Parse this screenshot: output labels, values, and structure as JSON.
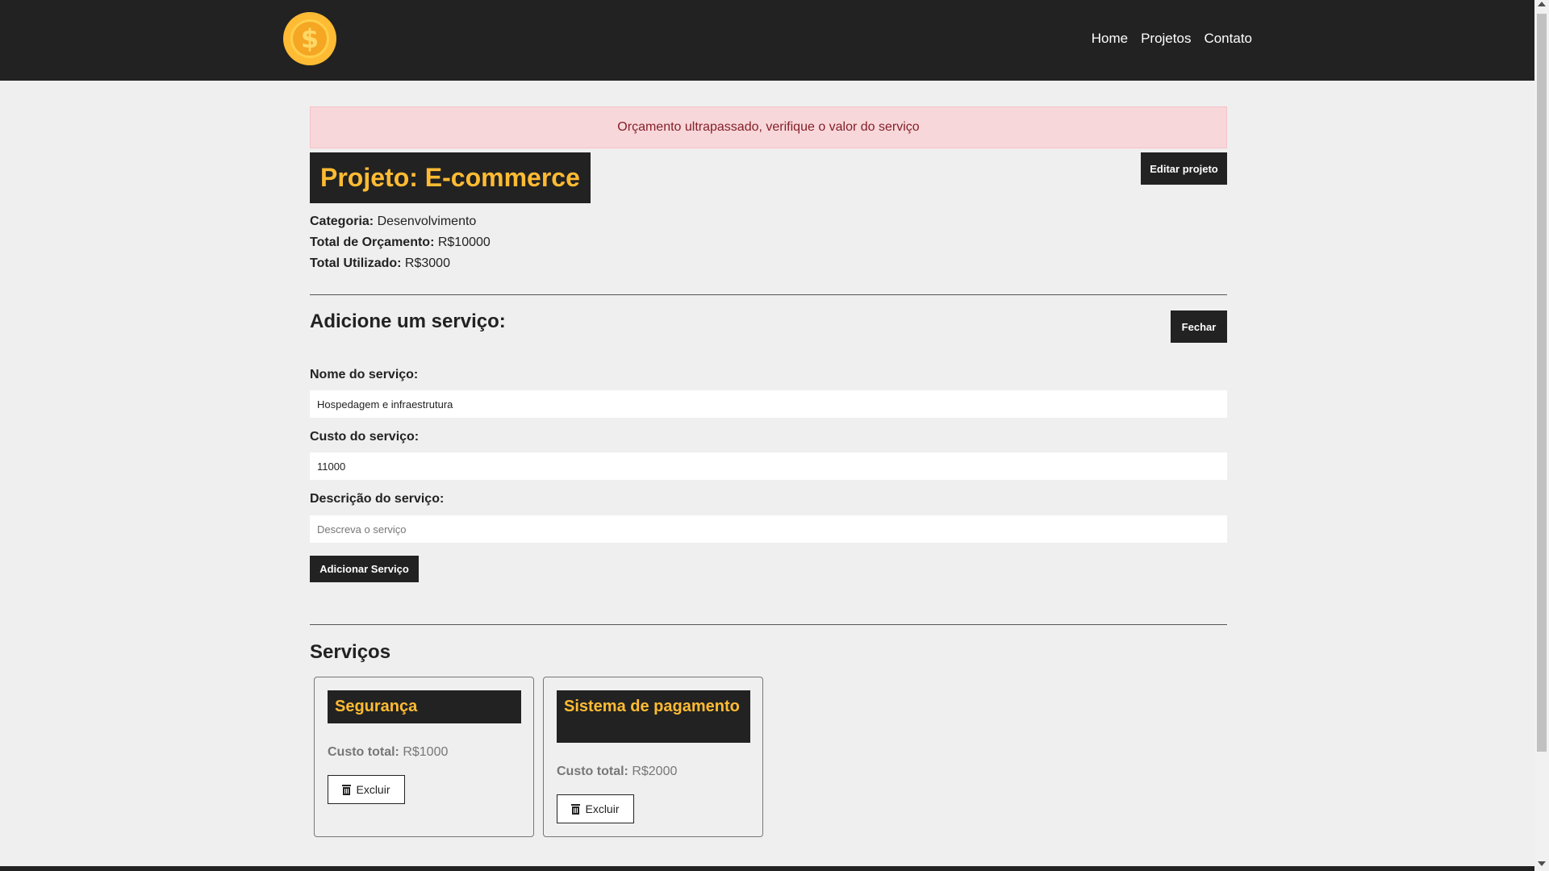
{
  "navbar": {
    "logo_symbol": "$",
    "links": [
      "Home",
      "Projetos",
      "Contato"
    ]
  },
  "alert": {
    "message": "Orçamento ultrapassado, verifique o valor do serviço",
    "color": "#f8d7da"
  },
  "project": {
    "title": "Projeto: E-commerce",
    "edit_label": "Editar projeto",
    "category_label": "Categoria:",
    "category_value": "Desenvolvimento",
    "budget_label": "Total de Orçamento:",
    "budget_value": "R$10000",
    "used_label": "Total Utilizado:",
    "used_value": "R$3000"
  },
  "service_form": {
    "heading": "Adicione um serviço:",
    "close_label": "Fechar",
    "name_label": "Nome do serviço:",
    "name_value": "Hospedagem e infraestrutura",
    "cost_label": "Custo do serviço:",
    "cost_value": "11000",
    "desc_label": "Descrição do serviço:",
    "desc_placeholder": "Descreva o serviço",
    "submit_label": "Adicionar Serviço"
  },
  "services": {
    "heading": "Serviços",
    "items": [
      {
        "name": "Segurança",
        "cost_label": "Custo total:",
        "cost_value": "R$1000",
        "delete_label": "Excluir"
      },
      {
        "name": "Sistema de pagamento",
        "cost_label": "Custo total:",
        "cost_value": "R$2000",
        "delete_label": "Excluir"
      }
    ]
  },
  "colors": {
    "dark": "#222222",
    "accent": "#ffbb33",
    "background": "#efefef"
  },
  "icons": {
    "logo": "coin-icon",
    "delete": "trash-icon"
  }
}
